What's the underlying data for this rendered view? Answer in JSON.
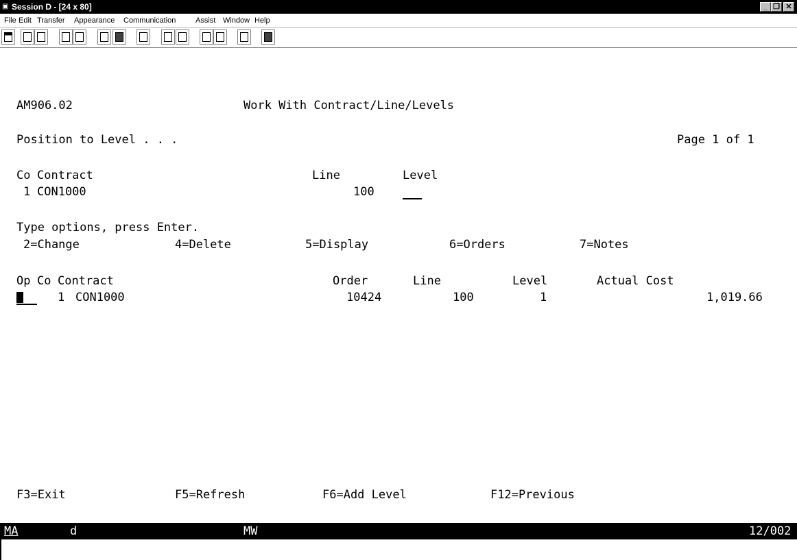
{
  "window": {
    "title": "Session D - [24 x 80]",
    "minimize_label": "_",
    "restore_label": "❐",
    "close_label": "✕"
  },
  "menu": {
    "items": [
      {
        "u": "F",
        "rest": "ile"
      },
      {
        "u": "E",
        "rest": "dit"
      },
      {
        "u": "T",
        "rest": "ransfer"
      },
      {
        "u": "",
        "rest": "Appearance",
        "pre": "Ap",
        "u2": "p",
        "post": "earance"
      },
      {
        "u": "C",
        "rest": "ommunication"
      },
      {
        "pre": "As",
        "u2": "s",
        "post": "ist"
      },
      {
        "u": "W",
        "rest": "indow"
      },
      {
        "u": "H",
        "rest": "elp"
      }
    ],
    "labels": [
      "File",
      "Edit",
      "Transfer",
      "Appearance",
      "Communication",
      "Assist",
      "Window",
      "Help"
    ]
  },
  "screen": {
    "program_id": "AM906.02",
    "screen_title": "Work With Contract/Line/Levels",
    "position_prompt": "Position to Level . . .",
    "page_info": "Page 1 of 1",
    "header": {
      "co_label": "Co",
      "contract_label": "Contract",
      "line_label": "Line",
      "level_label": "Level",
      "co_value": "1",
      "contract_value": "CON1000",
      "line_value": "100",
      "level_value": ""
    },
    "instructions": "Type options, press Enter.",
    "options": [
      "2=Change",
      "4=Delete",
      "5=Display",
      "6=Orders",
      "7=Notes"
    ],
    "columns": {
      "op": "Op",
      "co": "Co",
      "contract": "Contract",
      "order": "Order",
      "line": "Line",
      "level": "Level",
      "actual_cost": "Actual Cost"
    },
    "rows": [
      {
        "op": "",
        "co": "1",
        "contract": "CON1000",
        "order": "10424",
        "line": "100",
        "level": "1",
        "actual_cost": "1,019.66"
      }
    ],
    "function_keys": [
      "F3=Exit",
      "F5=Refresh",
      "F6=Add Level",
      "F12=Previous"
    ]
  },
  "status": {
    "indicator": "MA",
    "session": "d",
    "mode": "MW",
    "cursor_position": "12/002"
  }
}
